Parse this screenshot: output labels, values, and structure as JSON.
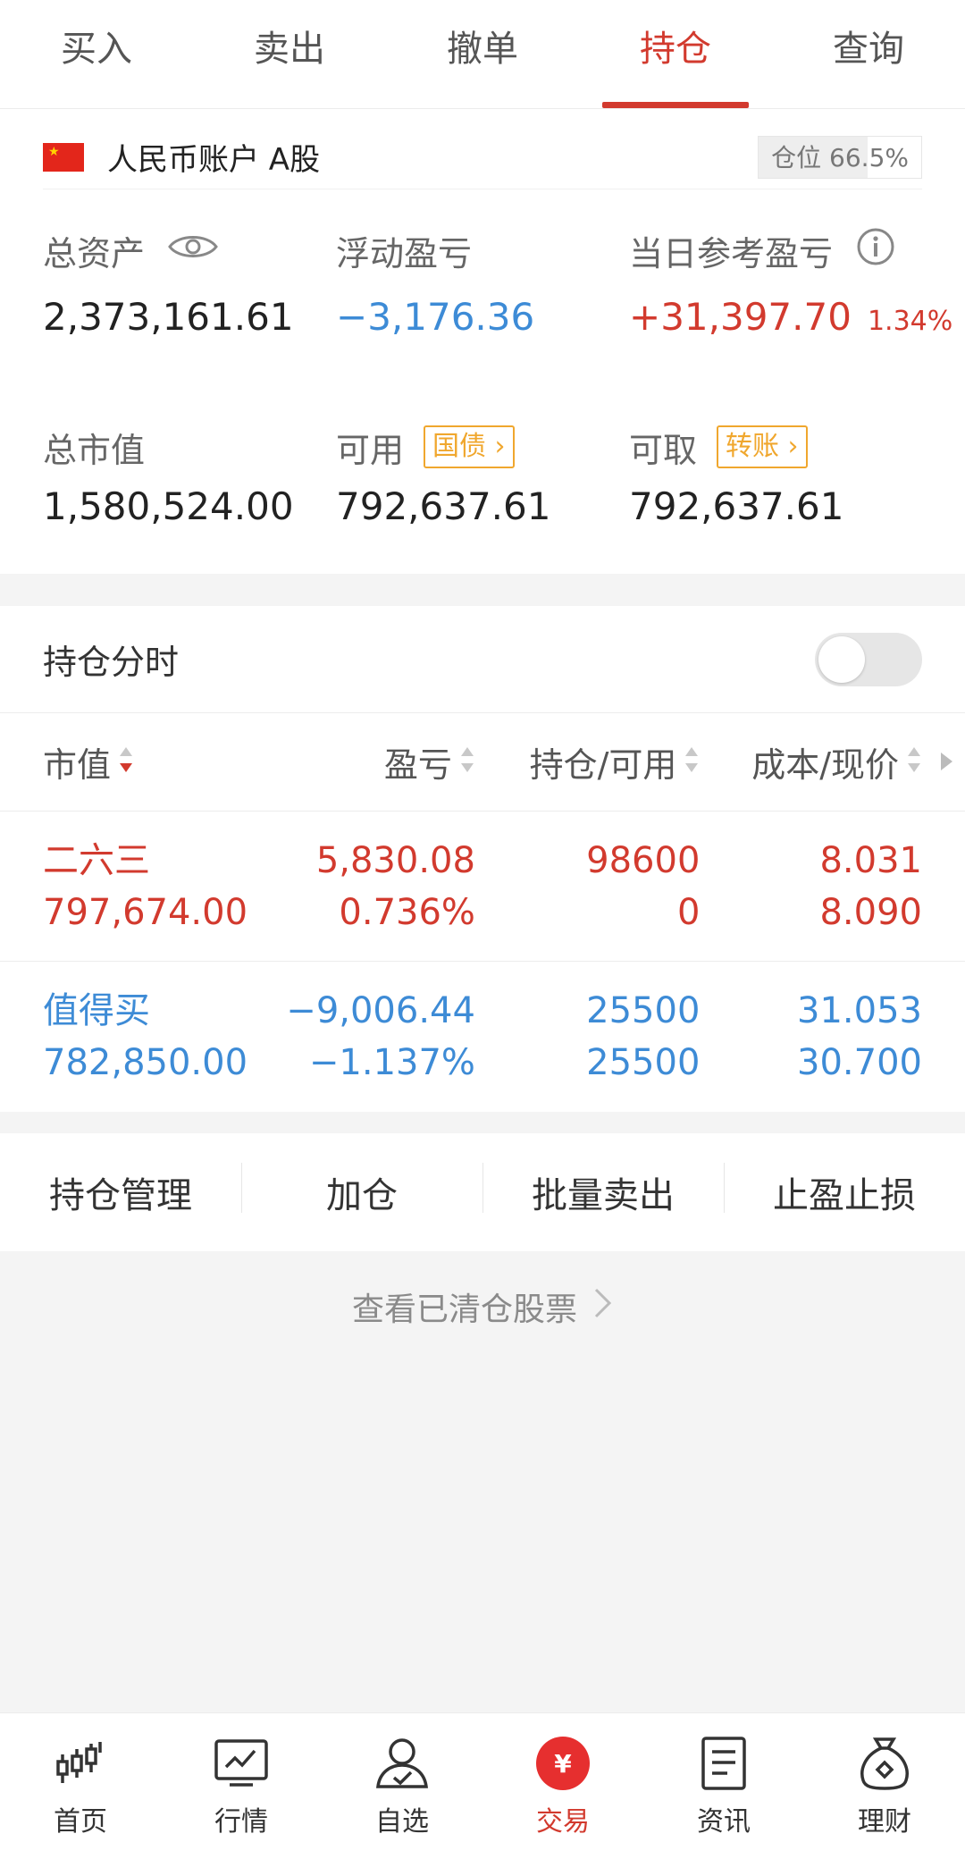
{
  "top_tabs": [
    "买入",
    "卖出",
    "撤单",
    "持仓",
    "查询"
  ],
  "active_tab": "持仓",
  "account": {
    "name": "人民币账户 A股",
    "position_label": "仓位 66.5%",
    "position_pct": 66.5
  },
  "metrics": {
    "total_assets_label": "总资产",
    "total_assets_value": "2,373,161.61",
    "floating_pl_label": "浮动盈亏",
    "floating_pl_value": "−3,176.36",
    "daily_pl_label": "当日参考盈亏",
    "daily_pl_value": "+31,397.70",
    "daily_pl_pct": "1.34%",
    "market_value_label": "总市值",
    "market_value_value": "1,580,524.00",
    "available_label": "可用",
    "available_tag": "国债",
    "available_value": "792,637.61",
    "withdrawable_label": "可取",
    "withdrawable_tag": "转账",
    "withdrawable_value": "792,637.61"
  },
  "positions": {
    "timeshare_label": "持仓分时",
    "timeshare_enabled": false,
    "columns": [
      "市值",
      "盈亏",
      "持仓/可用",
      "成本/现价"
    ],
    "rows": [
      {
        "name": "二六三",
        "market_value": "797,674.00",
        "pl": "5,830.08",
        "pl_pct": "0.736%",
        "hold": "98600",
        "available": "0",
        "cost": "8.031",
        "price": "8.090",
        "trend": "up"
      },
      {
        "name": "值得买",
        "market_value": "782,850.00",
        "pl": "−9,006.44",
        "pl_pct": "−1.137%",
        "hold": "25500",
        "available": "25500",
        "cost": "31.053",
        "price": "30.700",
        "trend": "down"
      }
    ]
  },
  "actions": [
    "持仓管理",
    "加仓",
    "批量卖出",
    "止盈止损"
  ],
  "cleared_link": "查看已清仓股票",
  "bottom_nav": [
    {
      "label": "首页",
      "icon": "candlestick-icon"
    },
    {
      "label": "行情",
      "icon": "chart-icon"
    },
    {
      "label": "自选",
      "icon": "person-check-icon"
    },
    {
      "label": "交易",
      "icon": "yen-icon"
    },
    {
      "label": "资讯",
      "icon": "document-icon"
    },
    {
      "label": "理财",
      "icon": "money-bag-icon"
    }
  ],
  "active_nav": "交易",
  "colors": {
    "accent": "#d23a2e",
    "down": "#3d8bd6",
    "tag": "#f0a72e"
  }
}
